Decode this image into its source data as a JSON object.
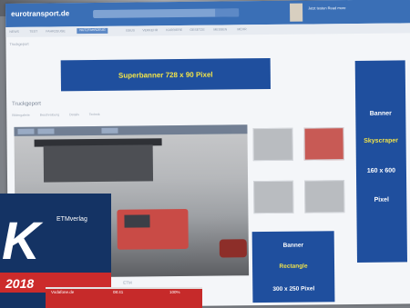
{
  "header": {
    "logo": "eurotransport.de",
    "search_placeholder": "",
    "search_button": "",
    "magazine_promo": "Jetzt testen\nRead more"
  },
  "nav": {
    "items": [
      "NEWS",
      "TEST",
      "FAHRZEUGE",
      "NUTZFAHRZEUG",
      "EBUS",
      "VERKEHR",
      "KARRIERE",
      "GESETZE",
      "MESSEN",
      "MEHR"
    ],
    "active": "NUTZFAHRZEUG"
  },
  "subnav": "Truckgeport",
  "ads": {
    "superbanner": "Superbanner 728 x 90 Pixel",
    "skyscraper": [
      "Banner",
      "Skyscraper",
      "160 x 600",
      "Pixel"
    ],
    "rectangle": [
      "Banner",
      "Rectangle",
      "300 x 250 Pixel"
    ]
  },
  "section": {
    "title": "Truckgeport",
    "tabs": [
      "Bildergalerie",
      "Beschreibung",
      "Details",
      "Technik"
    ]
  },
  "bottom_text": "ETM",
  "book": {
    "logo": "ETMverlag",
    "title": "K",
    "year": "2018"
  },
  "phone": {
    "status": "Vodafone.de",
    "time": "08:41",
    "battery": "100%"
  },
  "colors": {
    "brand_blue": "#3a6fb6",
    "ad_blue": "#1f4f9e",
    "ad_yellow": "#f1e34a",
    "book_red": "#cc2b2b"
  }
}
